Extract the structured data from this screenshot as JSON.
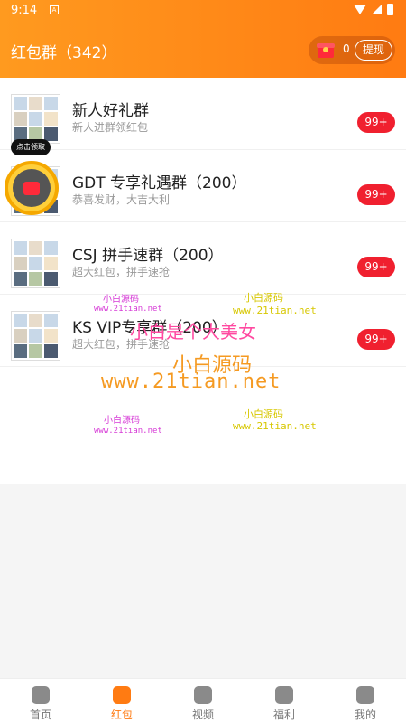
{
  "status": {
    "time": "9:14",
    "sim": "A"
  },
  "header": {
    "title": "红包群（342）",
    "coin_count": "0",
    "withdraw": "提现"
  },
  "groups": [
    {
      "name": "新人好礼群",
      "desc": "新人进群领红包",
      "badge": "99+"
    },
    {
      "name": "GDT 专享礼遇群（200）",
      "desc": "恭喜发财，大吉大利",
      "badge": "99+"
    },
    {
      "name": "CSJ 拼手速群（200）",
      "desc": "超大红包，拼手速抢",
      "badge": "99+"
    },
    {
      "name": "KS VIP专享群（200）",
      "desc": "超大红包，拼手速抢",
      "badge": "99+"
    }
  ],
  "float": {
    "tip": "点击领取"
  },
  "watermarks": {
    "a": "小白源码",
    "b": "www.21tian.net",
    "c": "小白是个大美女",
    "d": "小白源码",
    "e": "www.21tian.net"
  },
  "tabs": [
    {
      "label": "首页",
      "icon": "home-icon",
      "active": false
    },
    {
      "label": "红包",
      "icon": "red-packet-icon",
      "active": true
    },
    {
      "label": "视频",
      "icon": "video-icon",
      "active": false
    },
    {
      "label": "福利",
      "icon": "gift-icon",
      "active": false
    },
    {
      "label": "我的",
      "icon": "user-icon",
      "active": false
    }
  ],
  "colors": {
    "accent": "#ff7b12",
    "badge": "#f0202f"
  }
}
